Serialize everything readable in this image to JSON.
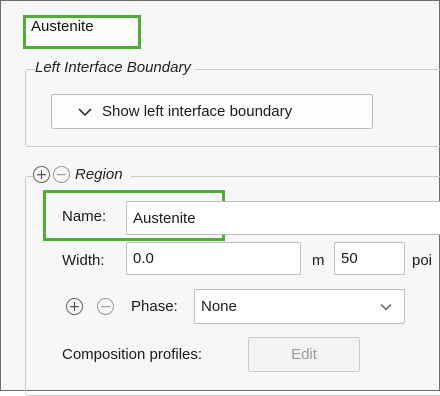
{
  "title_tab": {
    "label": "Austenite"
  },
  "left_interface": {
    "legend": "Left Interface Boundary",
    "toggle_button": "Show left interface boundary"
  },
  "region": {
    "legend": "Region",
    "name_label": "Name:",
    "name_value": "Austenite",
    "width_label": "Width:",
    "width_value": "0.0",
    "width_unit": "m",
    "points_value": "50",
    "points_label": "poi",
    "phase_label": "Phase:",
    "phase_value": "None",
    "composition_label": "Composition profiles:",
    "edit_button": "Edit"
  },
  "colors": {
    "highlight": "#4caf2e"
  },
  "icons": [
    "chevron-down-icon",
    "plus-circle-icon",
    "minus-circle-icon"
  ]
}
